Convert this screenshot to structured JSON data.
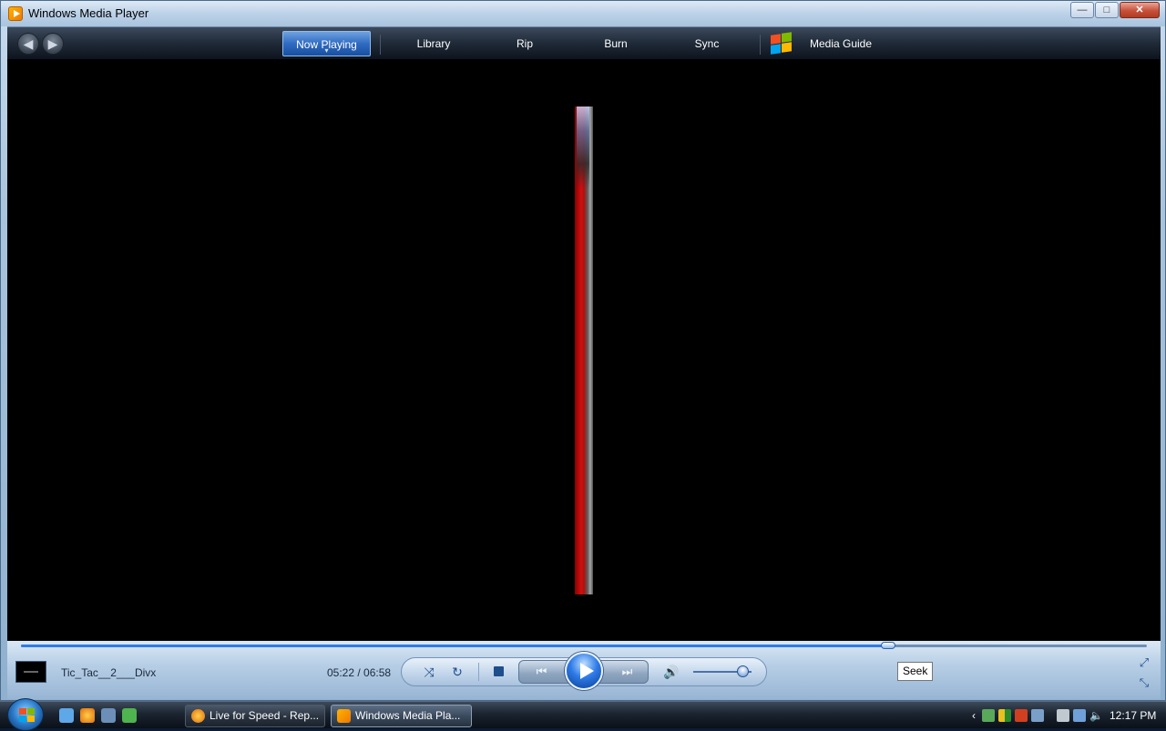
{
  "window": {
    "title": "Windows Media Player",
    "controls": {
      "minimize": "—",
      "maximize": "□",
      "close": "✕"
    }
  },
  "nav": {
    "back_icon": "arrow-left-icon",
    "forward_icon": "arrow-right-icon",
    "tabs": [
      {
        "label": "Now Playing",
        "active": true
      },
      {
        "label": "Library"
      },
      {
        "label": "Rip"
      },
      {
        "label": "Burn"
      },
      {
        "label": "Sync"
      },
      {
        "label": "Media Guide"
      }
    ]
  },
  "player": {
    "track_name": "Tic_Tac__2___Divx",
    "time": "05:22 / 06:58",
    "seek_progress": 0.77,
    "volume_level": 0.85,
    "tooltip": "Seek",
    "icons": {
      "shuffle": "shuffle-icon",
      "repeat": "repeat-icon",
      "stop": "stop-icon",
      "previous": "previous-icon",
      "play": "play-icon",
      "next": "next-icon",
      "mute": "speaker-icon",
      "switch_to_mini": "mini-player-icon",
      "full_screen": "full-screen-icon"
    }
  },
  "taskbar": {
    "tasks": [
      {
        "label": "Live for Speed - Rep...",
        "icon": "firefox-icon"
      },
      {
        "label": "Windows Media Pla...",
        "icon": "media-player-icon",
        "active": true
      }
    ],
    "clock": "12:17 PM"
  }
}
